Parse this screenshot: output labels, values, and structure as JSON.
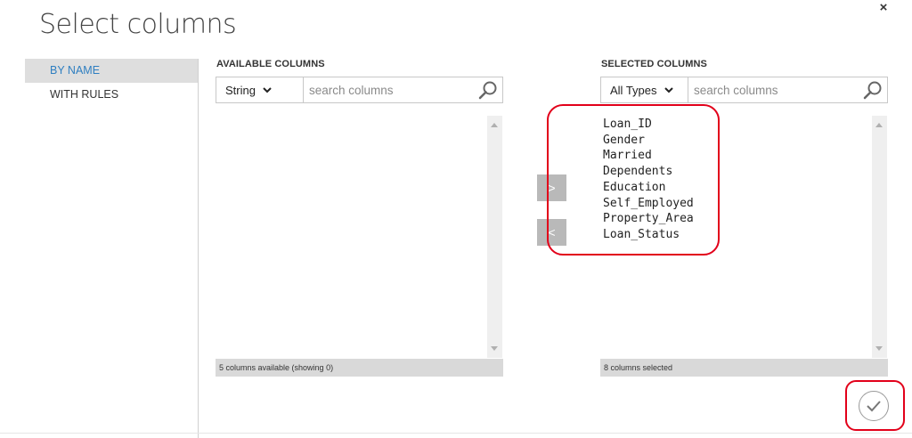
{
  "dialog": {
    "title": "Select columns",
    "close_label": "×"
  },
  "sidebar": {
    "items": [
      {
        "label": "BY NAME",
        "active": true
      },
      {
        "label": "WITH RULES",
        "active": false
      }
    ]
  },
  "available": {
    "header": "AVAILABLE COLUMNS",
    "type_filter": "String",
    "search_placeholder": "search columns",
    "status": "5 columns available (showing 0)"
  },
  "selected": {
    "header": "SELECTED COLUMNS",
    "type_filter": "All Types",
    "search_placeholder": "search columns",
    "status": "8 columns selected",
    "columns": [
      "Loan_ID",
      "Gender",
      "Married",
      "Dependents",
      "Education",
      "Self_Employed",
      "Property_Area",
      "Loan_Status"
    ]
  },
  "transfer": {
    "add_label": ">",
    "remove_label": "<"
  },
  "icons": {
    "search": "search-icon",
    "dropdown": "chevron-down-icon",
    "confirm": "checkmark-icon",
    "close": "close-icon"
  },
  "colors": {
    "accent": "#2f7fc1",
    "highlight": "#e2001a",
    "button_gray": "#b9b9b9",
    "status_bg": "#d9d9d9"
  }
}
